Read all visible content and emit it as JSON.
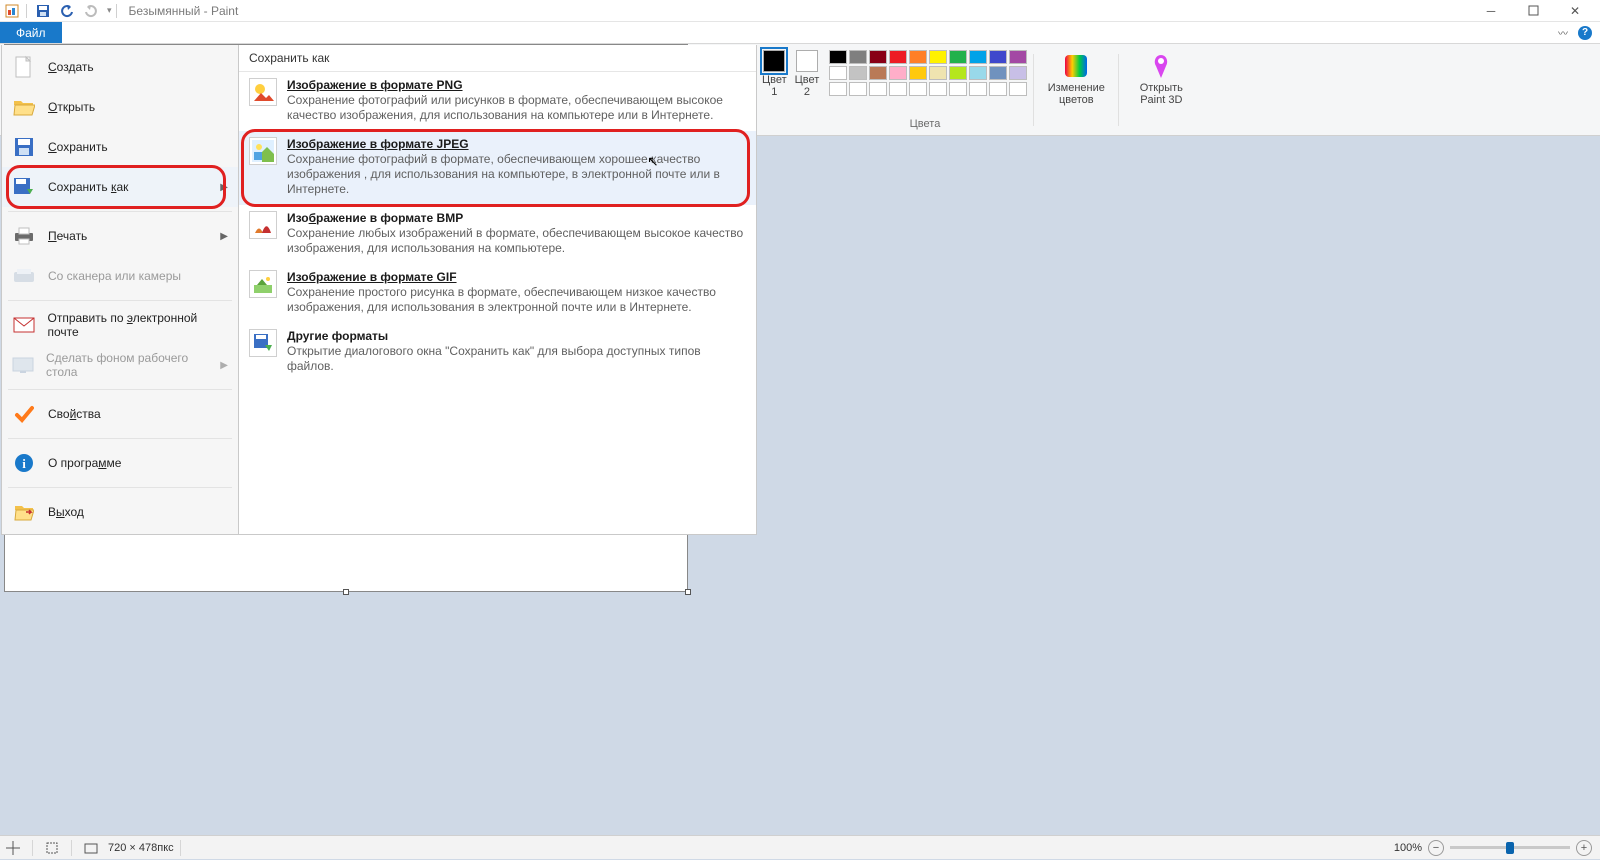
{
  "window": {
    "title": "Безымянный - Paint"
  },
  "tabs": {
    "file": "Файл"
  },
  "ribbon": {
    "color1": "Цвет\n1",
    "color2": "Цвет\n2",
    "edit_colors": "Изменение\nцветов",
    "open_3d": "Открыть\nPaint 3D",
    "group_colors": "Цвета",
    "palette_row1": [
      "#000000",
      "#7f7f7f",
      "#880015",
      "#ed1c24",
      "#ff7f27",
      "#fff200",
      "#22b14c",
      "#00a2e8",
      "#3f48cc",
      "#a349a4"
    ],
    "palette_row2": [
      "#ffffff",
      "#c3c3c3",
      "#b97a57",
      "#ffaec9",
      "#ffc90e",
      "#efe4b0",
      "#b5e61d",
      "#99d9ea",
      "#7092be",
      "#c8bfe7"
    ],
    "palette_row3": [
      "#ffffff",
      "#ffffff",
      "#ffffff",
      "#ffffff",
      "#ffffff",
      "#ffffff",
      "#ffffff",
      "#ffffff",
      "#ffffff",
      "#ffffff"
    ]
  },
  "backstage": {
    "items": {
      "create": "Создать",
      "open": "Открыть",
      "save": "Сохранить",
      "save_as": "Сохранить как",
      "print": "Печать",
      "scanner": "Со сканера или камеры",
      "email": "Отправить по электронной почте",
      "wallpaper": "Сделать фоном рабочего стола",
      "properties": "Свойства",
      "about": "О программе",
      "exit": "Выход"
    }
  },
  "save_as": {
    "header": "Сохранить как",
    "png": {
      "title": "Изображение в формате PNG",
      "desc": "Сохранение фотографий или рисунков в формате, обеспечивающем высокое качество изображения, для использования на компьютере или в Интернете."
    },
    "jpeg": {
      "title": "Изображение в формате JPEG",
      "desc": "Сохранение фотографий в формате, обеспечивающем хорошее качество изображения , для использования на компьютере, в электронной почте или в Интернете."
    },
    "bmp": {
      "title": "Изображение в формате BMP",
      "desc": "Сохранение любых изображений в формате, обеспечивающем высокое качество изображения, для использования на компьютере."
    },
    "gif": {
      "title": "Изображение в формате GIF",
      "desc": "Сохранение простого рисунка в формате, обеспечивающем низкое качество изображения, для использования в электронной почте или в Интернете."
    },
    "other": {
      "title": "Другие форматы",
      "desc": "Открытие диалогового окна \"Сохранить как\" для выбора доступных типов файлов."
    }
  },
  "status": {
    "dimensions": "720 × 478пкс",
    "zoom": "100%"
  }
}
